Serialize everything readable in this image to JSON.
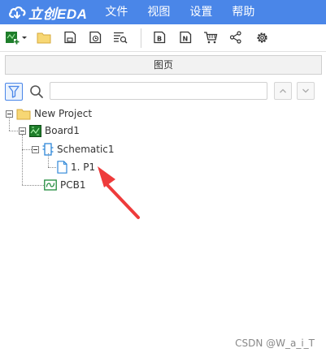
{
  "app": {
    "logo_text": "立创EDA",
    "menu": [
      "文件",
      "视图",
      "设置",
      "帮助"
    ]
  },
  "toolbar": {
    "buttons": [
      "new-dropdown",
      "open-folder",
      "save",
      "save-as",
      "find",
      "bom",
      "netlist",
      "cart",
      "share",
      "settings"
    ]
  },
  "panel": {
    "tab_label": "图页",
    "search": {
      "value": "",
      "placeholder": ""
    }
  },
  "tree": {
    "project": "New Project",
    "board": "Board1",
    "schematic": "Schematic1",
    "sheet": "1. P1",
    "pcb": "PCB1"
  },
  "colors": {
    "topbar": "#4a86e8",
    "accent": "#4a86e8",
    "board_icon": "#1e7d2a",
    "arrow": "#ee3b3b"
  },
  "watermark": "CSDN @W_a_i_T"
}
